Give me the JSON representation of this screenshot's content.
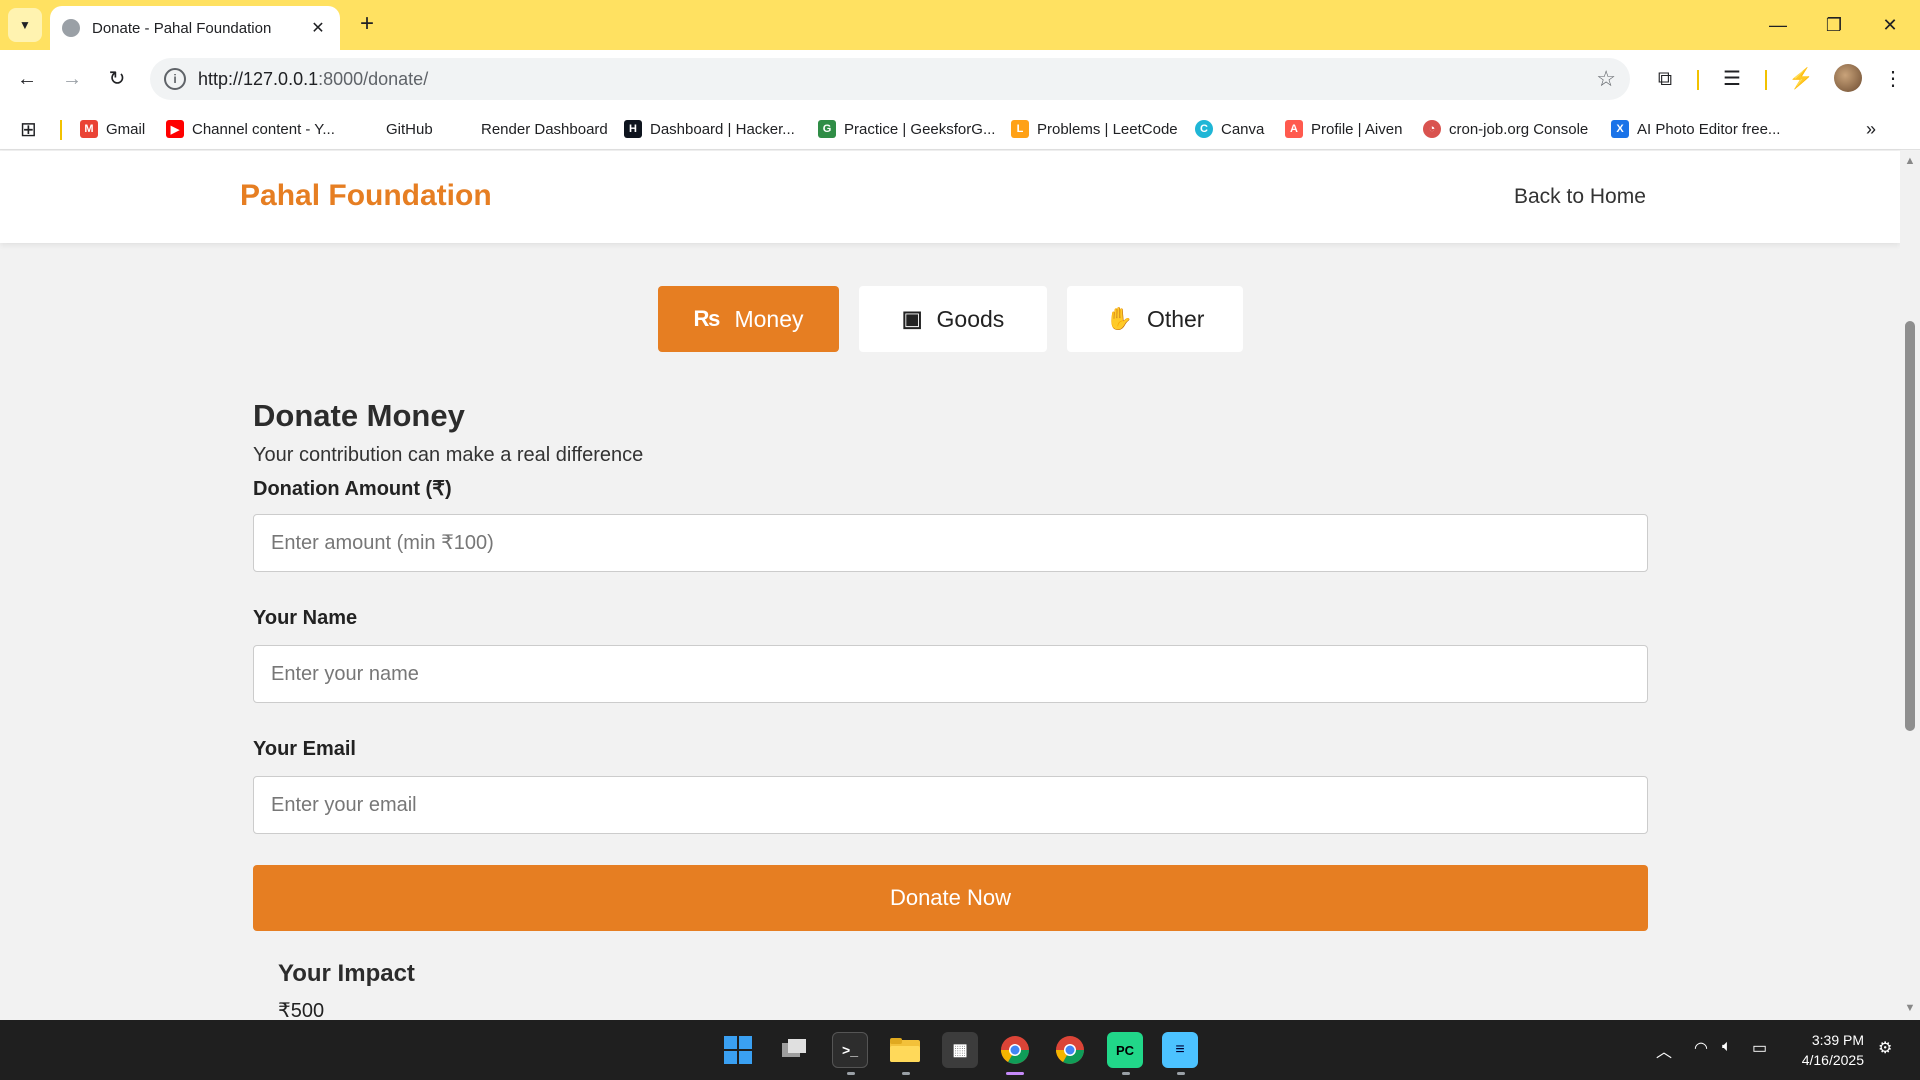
{
  "browser": {
    "tab_title": "Donate - Pahal Foundation",
    "tab_close": "✕",
    "new_tab": "+",
    "url_host": "http://127.0.0.1",
    "url_rest": ":8000/donate/",
    "window_controls": {
      "minimize": "—",
      "restore": "❐",
      "close": "✕"
    }
  },
  "bookmarks": [
    {
      "label": "Gmail",
      "icon": "gmail-icon",
      "color": "#ea4335",
      "glyph": "M"
    },
    {
      "label": "Channel content - Y...",
      "icon": "youtube-icon",
      "color": "#ff0000",
      "glyph": "▶"
    },
    {
      "label": "GitHub",
      "icon": "github-icon",
      "color": "#ffffff",
      "glyph": ""
    },
    {
      "label": "Render Dashboard",
      "icon": "render-icon",
      "color": "#ffffff",
      "glyph": ""
    },
    {
      "label": "Dashboard | Hacker...",
      "icon": "hackerrank-icon",
      "color": "#0e141e",
      "glyph": "H"
    },
    {
      "label": "Practice | GeeksforG...",
      "icon": "geeksforgeeks-icon",
      "color": "#2f8d46",
      "glyph": "G"
    },
    {
      "label": "Problems | LeetCode",
      "icon": "leetcode-icon",
      "color": "#ffa116",
      "glyph": "L"
    },
    {
      "label": "Canva",
      "icon": "canva-icon",
      "color": "#1fb6d6",
      "glyph": "C"
    },
    {
      "label": "Profile | Aiven",
      "icon": "aiven-icon",
      "color": "#ff5a4e",
      "glyph": "A"
    },
    {
      "label": "cron-job.org Console",
      "icon": "cronjob-icon",
      "color": "#d9534f",
      "glyph": "◔"
    },
    {
      "label": "AI Photo Editor free...",
      "icon": "photo-editor-icon",
      "color": "#1a73e8",
      "glyph": "X"
    }
  ],
  "header": {
    "brand": "Pahal Foundation",
    "back_link": "Back to Home"
  },
  "donation_types": [
    {
      "label": "Money",
      "glyph": "₨",
      "icon": "rupee-icon",
      "active": true
    },
    {
      "label": "Goods",
      "glyph": "▣",
      "icon": "box-icon",
      "active": false
    },
    {
      "label": "Other",
      "glyph": "✋",
      "icon": "hand-holding-icon",
      "active": false
    }
  ],
  "form": {
    "title": "Donate Money",
    "subtitle": "Your contribution can make a real difference",
    "amount_label": "Donation Amount (₹)",
    "amount_placeholder": "Enter amount (min ₹100)",
    "amount_value": "",
    "name_label": "Your Name",
    "name_placeholder": "Enter your name",
    "name_value": "",
    "email_label": "Your Email",
    "email_placeholder": "Enter your email",
    "email_value": "",
    "submit_label": "Donate Now"
  },
  "impact": {
    "title": "Your Impact",
    "amount": "₹500"
  },
  "taskbar": {
    "time": "3:39 PM",
    "date": "4/16/2025"
  },
  "colors": {
    "accent": "#e67e22",
    "browser_frame": "#ffe161"
  }
}
